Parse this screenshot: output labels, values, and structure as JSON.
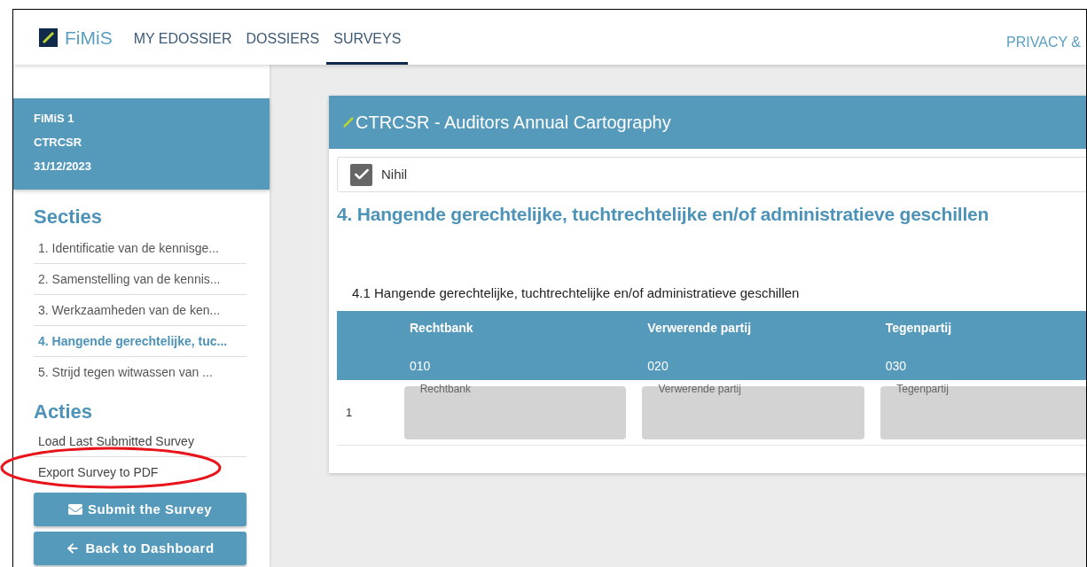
{
  "header": {
    "logo": "FiMiS",
    "nav": [
      {
        "label": "MY EDOSSIER",
        "selected": false
      },
      {
        "label": "DOSSIERS",
        "selected": false
      },
      {
        "label": "SURVEYS",
        "selected": true
      }
    ],
    "right_link": "PRIVACY &"
  },
  "sidebar": {
    "info": [
      "FiMiS 1",
      "CTRCSR",
      "31/12/2023"
    ],
    "sections_title": "Secties",
    "sections": [
      {
        "label": "1. Identificatie van de kennisge...",
        "selected": false
      },
      {
        "label": "2. Samenstelling van de kennis...",
        "selected": false
      },
      {
        "label": "3. Werkzaamheden van de ken...",
        "selected": false
      },
      {
        "label": "4. Hangende gerechtelijke, tuc...",
        "selected": true
      },
      {
        "label": "5. Strijd tegen witwassen van ...",
        "selected": false
      }
    ],
    "actions_title": "Acties",
    "actions": [
      "Load Last Submitted Survey",
      "Export Survey to PDF"
    ],
    "buttons": [
      {
        "label": "Submit the Survey",
        "kind": "submit"
      },
      {
        "label": "Back to Dashboard",
        "kind": "back"
      }
    ]
  },
  "annotation": {
    "kind": "ellipse",
    "color": "#e8141b"
  },
  "card": {
    "title": "CTRCSR - Auditors Annual Cartography",
    "nihil": {
      "label": "Nihil",
      "checked": true
    },
    "heading": "4. Hangende gerechtelijke, tuchtrechtelijke en/of administratieve geschillen",
    "subheading": "4.1 Hangende gerechtelijke, tuchtrechtelijke en/of administratieve geschillen",
    "table": {
      "columns": [
        {
          "name": "Rechtbank",
          "code": "010"
        },
        {
          "name": "Verwerende partij",
          "code": "020"
        },
        {
          "name": "Tegenpartij",
          "code": "030"
        }
      ],
      "rows": [
        {
          "number": "1",
          "fields": [
            {
              "placeholder": "Rechtbank"
            },
            {
              "placeholder": "Verwerende partij"
            },
            {
              "placeholder": "Tegenpartij"
            }
          ]
        }
      ]
    }
  }
}
